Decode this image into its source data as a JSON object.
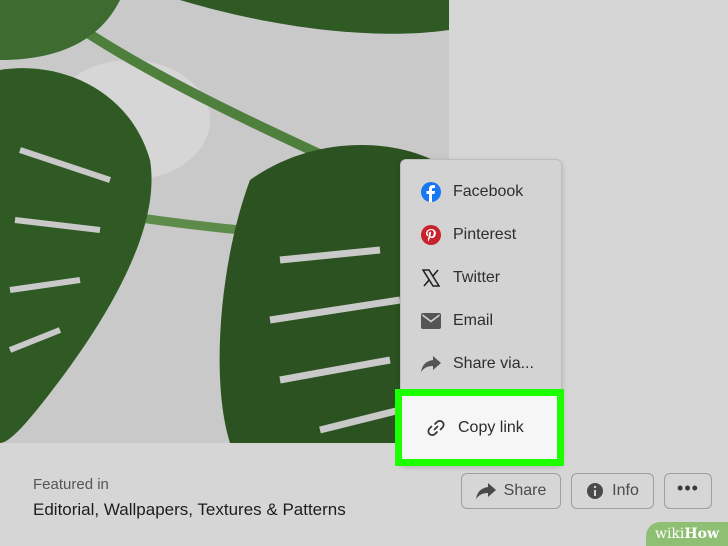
{
  "photo": {
    "alt_icon": "monstera-leaf-photo"
  },
  "featured": {
    "label": "Featured in",
    "value": "Editorial, Wallpapers, Textures & Patterns"
  },
  "actions": {
    "share_label": "Share",
    "info_label": "Info",
    "more_label": "•••"
  },
  "share_menu": {
    "items": [
      {
        "label": "Facebook",
        "icon": "facebook-icon",
        "color": "#1877f2"
      },
      {
        "label": "Pinterest",
        "icon": "pinterest-icon",
        "color": "#c8232c"
      },
      {
        "label": "Twitter",
        "icon": "x-twitter-icon",
        "color": "#222222"
      },
      {
        "label": "Email",
        "icon": "mail-icon",
        "color": "#555555"
      },
      {
        "label": "Share via...",
        "icon": "share-arrow-icon",
        "color": "#555555"
      }
    ],
    "copy_link": {
      "label": "Copy link",
      "icon": "link-icon"
    },
    "highlight_color": "#1bff00"
  },
  "watermark": {
    "prefix": "wiki",
    "brand": "How"
  }
}
